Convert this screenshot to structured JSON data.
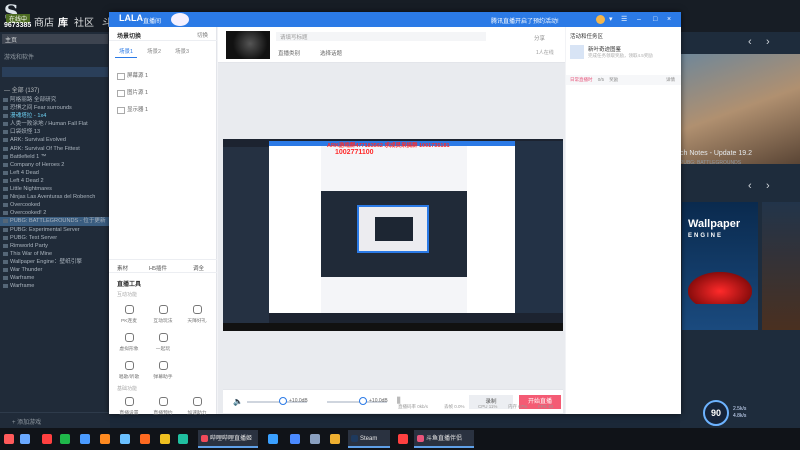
{
  "steam": {
    "logo": "S",
    "user_badge": "在线中",
    "user_id": "9673385",
    "nav": {
      "store": "商店",
      "library": "库",
      "community": "社区",
      "more": "斗"
    },
    "home_label": "主页",
    "filter_label": "游戏和软件",
    "all_header": "— 全部 (137)",
    "games": [
      "阿格丽路 全部研究",
      "恐惧之间 Fear surrounds",
      "漫魂塔拉 - 1x4",
      "人类一败涂地 / Human Fall Flat",
      "口袋妖怪 13",
      "ARK: Survival Evolved",
      "ARK: Survival Of The Fittest",
      "Battlefield 1 ™",
      "Company of Heroes 2",
      "Left 4 Dead",
      "Left 4 Dead 2",
      "Little Nightmares",
      "Ninjas Las Aventuras del Robench",
      "Overcooked",
      "Overcooked! 2",
      "PUBG: BATTLEGROUNDS - 位于更新",
      "PUBG: Experimental Server",
      "PUBG: Test Server",
      "Rimworld Party",
      "This War of Mine",
      "Wallpaper Engine：壁纸引擎",
      "War Thunder",
      "Warframe",
      "Warframe"
    ],
    "add_game": "+ 添加游戏",
    "news": {
      "title": "ch Notes - Update 19.2",
      "sub": "PUBG: BATTLEGROUNDS"
    },
    "wallpaper": {
      "title": "Wallpaper",
      "sub": "ENGINE"
    }
  },
  "app": {
    "logo": "LALA",
    "title": "直播间",
    "promo": "腾讯直播开启了预约活动!",
    "scene": {
      "title": "场景切换",
      "switch": "切换",
      "tabs": [
        "场景1",
        "场景2",
        "场景3"
      ]
    },
    "sources": [
      "屏幕源 1",
      "图片源 1",
      "显示器 1"
    ],
    "source_actions": {
      "add": "素材",
      "h5": "H5插件",
      "adjust": "调全"
    },
    "tools_title": "直播工具",
    "interact_label": "互动功能",
    "tools": [
      "PK连麦",
      "互动玩法",
      "天降好礼",
      "虚拟形象",
      "一起玩",
      "",
      "唱歌/听歌",
      "弹幕助手"
    ],
    "basic_label": "基础功能",
    "basic_tools": [
      "直播设置",
      "直播预约",
      "加速助力"
    ],
    "room": {
      "title_placeholder": "请填写标题",
      "category": "直播类别",
      "category2": "选择话题",
      "share": "分享",
      "viewers": "1人在线"
    },
    "overlay": {
      "text": "ARK游戏群477183562 求成员来搞群 1001735181",
      "number": "1002771100"
    },
    "mixer": {
      "db1": "+10.0dB",
      "db2": "+10.0dB",
      "record": "录制",
      "live": "开始直播"
    },
    "right": {
      "activity_title": "活动和任务区",
      "activity_name": "新叶奇迹图鉴",
      "activity_desc": "完成任务领取奖励，领取4.5奖励",
      "progress_label": "日常直播时",
      "progress_value": "0/5",
      "progress_reward": "奖励",
      "progress_action": "详情"
    },
    "status": {
      "bitrate": "直播码率 0kb/s",
      "dropped": "丢帧 0.0%",
      "cpu": "CPU 11%",
      "memory": "内存 67%",
      "fps": "FPS 30"
    }
  },
  "overlay_widget": {
    "fps": "90",
    "line1": "2.5k/s",
    "line2": "4.8k/s"
  },
  "taskbar": {
    "tasks": [
      "哔哩哔哩直播姬",
      "Steam",
      "斗鱼直播伴侣"
    ]
  }
}
